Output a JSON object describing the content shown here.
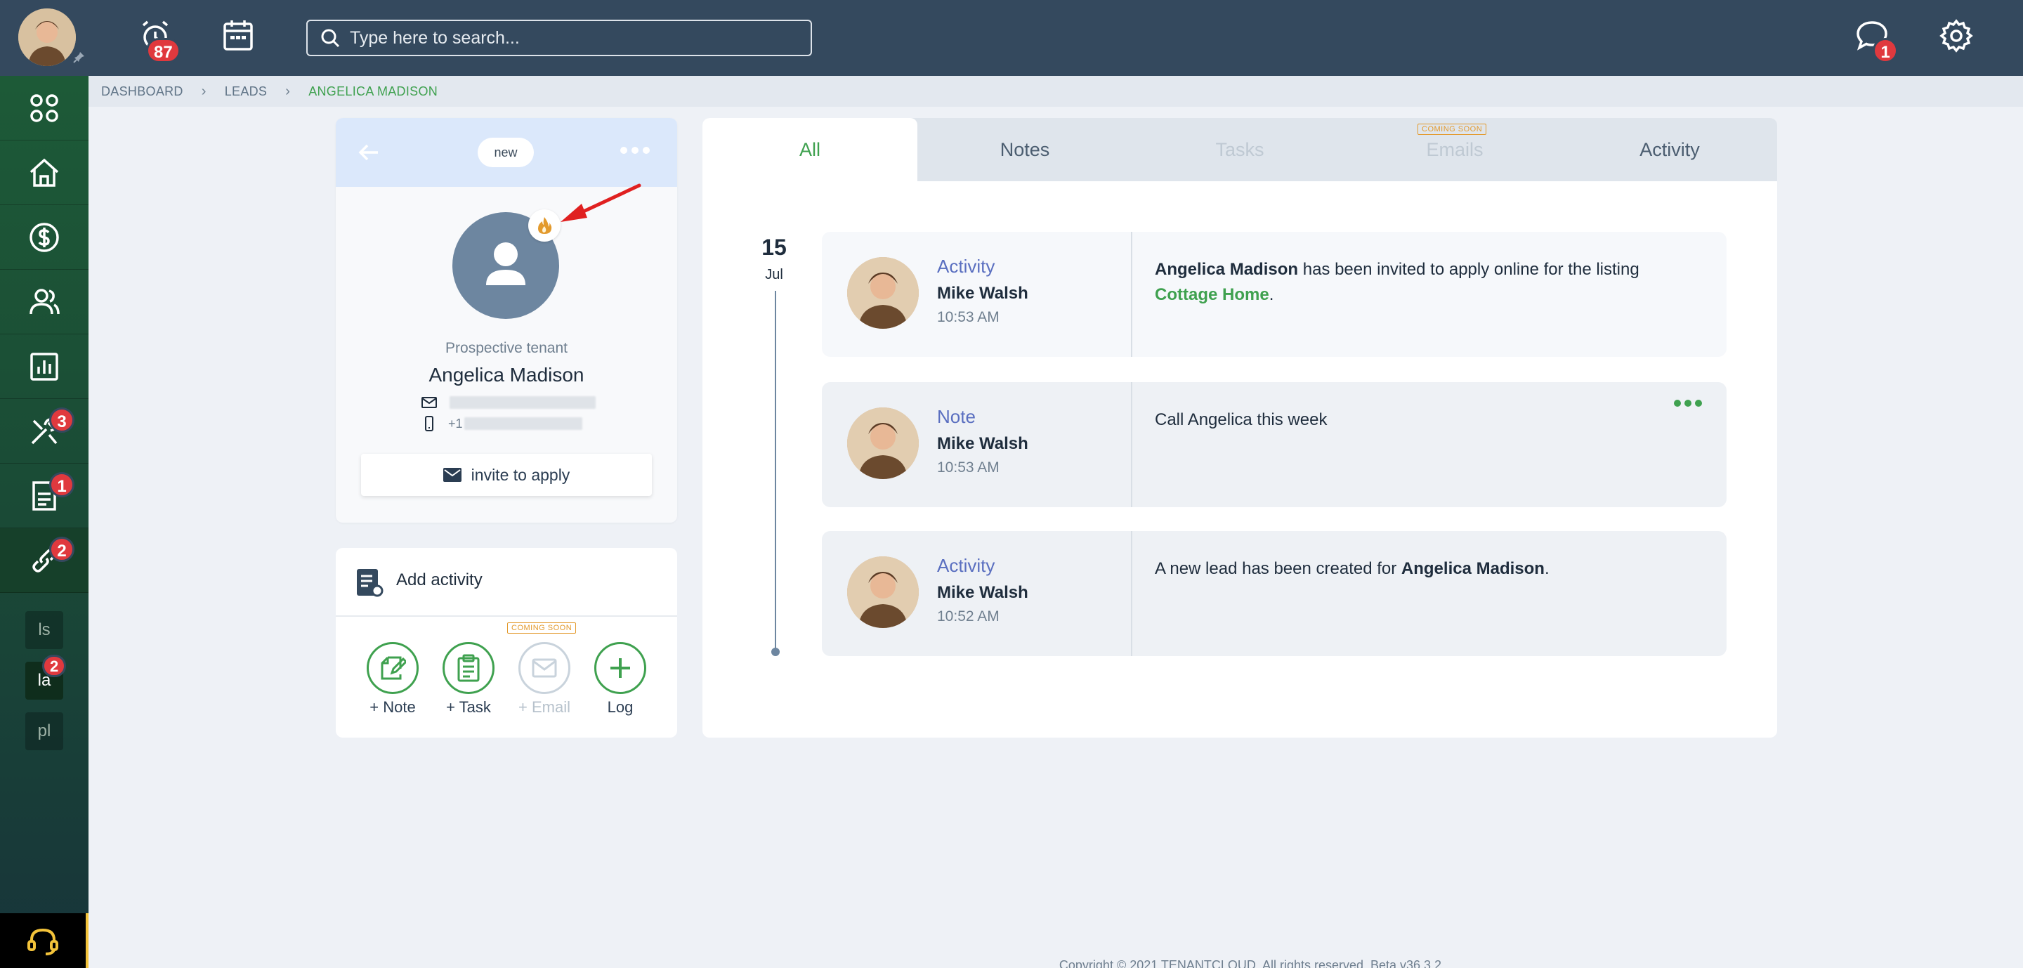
{
  "topbar": {
    "notifications_badge": "87",
    "chat_badge": "1",
    "search_placeholder": "Type here to search..."
  },
  "sidebar": {
    "tools_badge": "3",
    "documents_badge": "1",
    "links_badge": "2",
    "sub_items": [
      {
        "label": "ls"
      },
      {
        "label": "la",
        "badge": "2"
      },
      {
        "label": "pl"
      }
    ]
  },
  "breadcrumb": [
    "DASHBOARD",
    "LEADS",
    "ANGELICA MADISON"
  ],
  "profile": {
    "status": "new",
    "type": "Prospective tenant",
    "name": "Angelica Madison",
    "phone_prefix": "+1",
    "invite_label": "invite to apply"
  },
  "add_activity": {
    "title": "Add activity",
    "coming_soon": "COMING SOON",
    "actions": [
      {
        "label": "+ Note"
      },
      {
        "label": "+ Task"
      },
      {
        "label": "+ Email"
      },
      {
        "label": "Log"
      }
    ]
  },
  "tabs": [
    {
      "label": "All"
    },
    {
      "label": "Notes"
    },
    {
      "label": "Tasks"
    },
    {
      "label": "Emails"
    },
    {
      "label": "Activity"
    }
  ],
  "emails_coming_soon": "COMING SOON",
  "timeline": {
    "day": "15",
    "month": "Jul",
    "entries": [
      {
        "type": "Activity",
        "author": "Mike Walsh",
        "time": "10:53 AM",
        "bold_name": "Angelica Madison",
        "text": " has been invited to apply online for the listing ",
        "link": "Cottage Home",
        "tail": "."
      },
      {
        "type": "Note",
        "author": "Mike Walsh",
        "time": "10:53 AM",
        "text": "Call Angelica this week"
      },
      {
        "type": "Activity",
        "author": "Mike Walsh",
        "time": "10:52 AM",
        "text": "A new lead has been created for ",
        "bold_name": "Angelica Madison",
        "tail": "."
      }
    ]
  },
  "footer": "Copyright © 2021 TENANTCLOUD. All rights reserved. Beta v36.3.2",
  "colors": {
    "topbar": "#34495e",
    "accent_green": "#3fa14f",
    "badge_red": "#e0393e",
    "activity_type": "#5a6fc0"
  }
}
